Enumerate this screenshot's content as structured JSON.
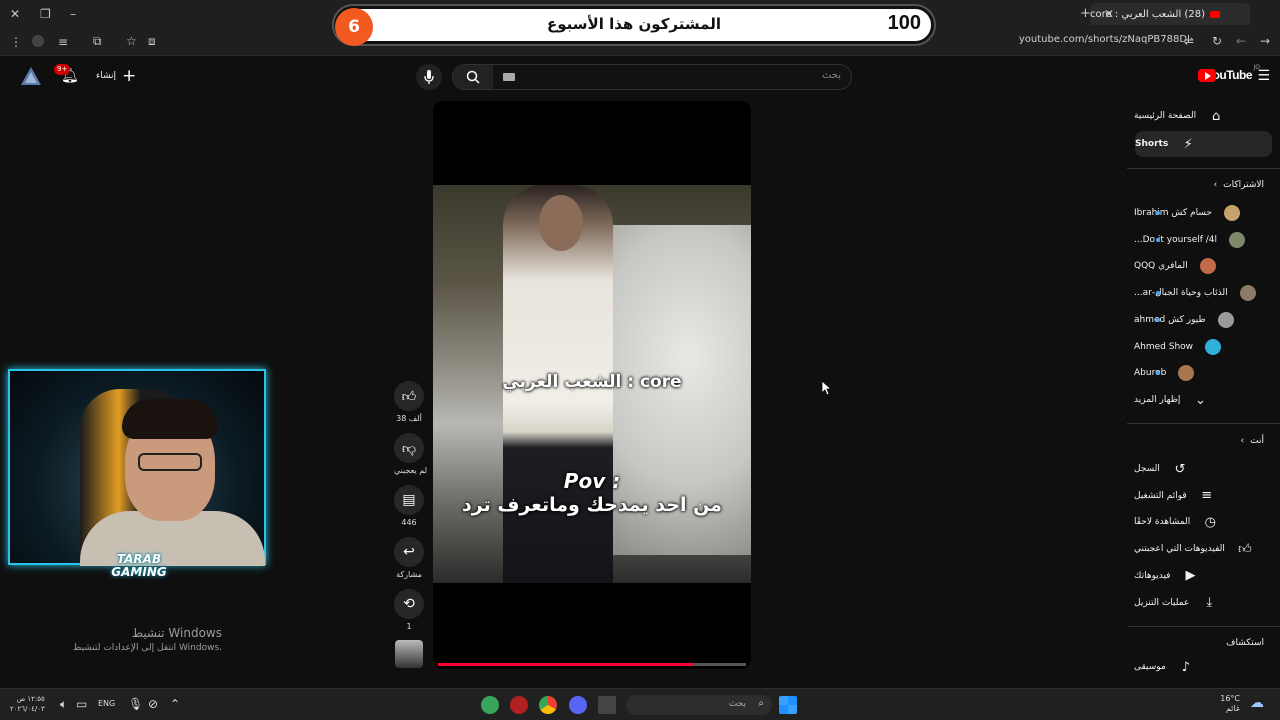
{
  "browser": {
    "tab_title": "(28) الشعب العربي : core",
    "url": "youtube.com/shorts/zNaqPB788DI"
  },
  "overlay": {
    "goal_count": "100",
    "title": "المشتركون هذا الأسبوع",
    "current_count": "6"
  },
  "header": {
    "logo": "YouTube",
    "logo_country": "JO",
    "search_placeholder": "بحث",
    "create_label": "إنشاء",
    "notification_count": "9+"
  },
  "short": {
    "caption_top": "الشعب العربي : core",
    "caption_pov": "Pov :",
    "caption_bottom": "من احد يمدحك وماتعرف ترد",
    "progress": 0.83
  },
  "actions": {
    "likes": "38 ألف",
    "dislike_label": "لم يعجبني",
    "comments": "446",
    "share_label": "مشاركة",
    "remix_count": "1"
  },
  "guide": {
    "home": "الصفحة الرئيسية",
    "shorts": "Shorts",
    "subscriptions_heading": "الاشتراكات",
    "subscriptions": [
      {
        "name": "حسام كش Ibrahim",
        "color": "#c7a36b",
        "dot": true
      },
      {
        "name": "Do it yourself /4l...",
        "color": "#7d8a6a",
        "dot": true
      },
      {
        "name": "المافري QQQ",
        "color": "#c26b4a",
        "dot": false
      },
      {
        "name": "الذئاب وحياة الجبال-ar...",
        "color": "#8a7a66",
        "dot": true
      },
      {
        "name": "طيور كش ahmed",
        "color": "#9a9a9a",
        "dot": true
      },
      {
        "name": "Ahmed Show",
        "color": "#2fb0d8",
        "dot": false
      },
      {
        "name": "Aburob",
        "color": "#a7764f",
        "dot": true
      }
    ],
    "show_more": "إظهار المزيد",
    "you_heading": "أنت",
    "you_items": [
      {
        "label": "السجل",
        "icon": "history-icon"
      },
      {
        "label": "قوائم التشغيل",
        "icon": "playlist-icon"
      },
      {
        "label": "المشاهدة لاحقًا",
        "icon": "watch-later-icon"
      },
      {
        "label": "الفيديوهات التي أعجبتني",
        "icon": "liked-videos-icon"
      },
      {
        "label": "فيديوهاتك",
        "icon": "your-videos-icon"
      },
      {
        "label": "عمليات التنزيل",
        "icon": "downloads-icon"
      }
    ],
    "explore_heading": "استكشاف",
    "music": "موسيقى"
  },
  "webcam": {
    "logo_line1": "TARAB",
    "logo_line2": "GAMING"
  },
  "windows_activation": {
    "title": "تنشيط Windows",
    "subtitle": "انتقل إلى الإعدادات لتنشيط Windows."
  },
  "taskbar": {
    "time": "١٢:٥٥ ص",
    "date": "٢٠٢٦/٠٤/٠٣",
    "language": "ENG",
    "search_placeholder": "بحث",
    "weather_temp": "16°C",
    "weather_desc": "غائم"
  }
}
